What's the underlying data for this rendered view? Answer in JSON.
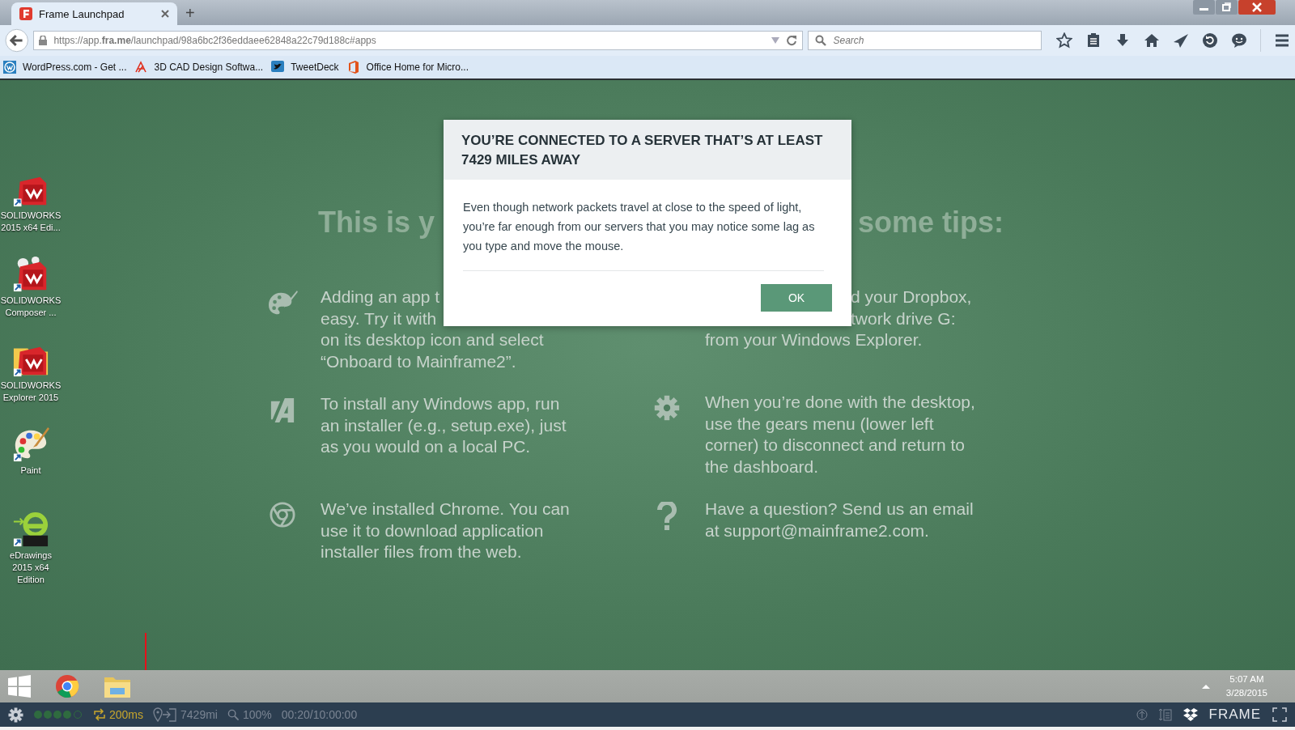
{
  "browser": {
    "tab": {
      "title": "Frame Launchpad",
      "selected": true
    },
    "new_tab": "+",
    "url": "https://app.**fra.me**/launchpad/98a6bc2f36eddaee62848a22c79d188c#apps",
    "search": {
      "placeholder": "Search"
    },
    "bookmarks": [
      {
        "label": "WordPress.com - Get ...",
        "kind": "wordpress"
      },
      {
        "label": "3D CAD Design Softwa...",
        "kind": "cad"
      },
      {
        "label": "TweetDeck",
        "kind": "tweetdeck"
      },
      {
        "label": "Office Home for Micro...",
        "kind": "office"
      }
    ]
  },
  "desktop": {
    "icons": [
      {
        "label": "SOLIDWORKS 2015 x64 Edi...",
        "kind": "solidworks"
      },
      {
        "label": "SOLIDWORKS Composer ...",
        "kind": "composer"
      },
      {
        "label": "SOLIDWORKS Explorer 2015",
        "kind": "explorer"
      },
      {
        "label": "Paint",
        "kind": "paint"
      },
      {
        "label": "eDrawings 2015 x64 Edition",
        "kind": "edrawings"
      }
    ],
    "heading_fragments": [
      "This is y",
      "some tips:"
    ],
    "tips_left": [
      {
        "kind": "palette",
        "lines": [
          "Adding an app t",
          "easy.  Try it with",
          "on its desktop icon and select",
          "“Onboard to Mainframe2”."
        ]
      },
      {
        "kind": "appstore",
        "lines": [
          "To install any Windows app, run",
          "an installer (e.g., setup.exe), just",
          "as you would on a local PC."
        ]
      },
      {
        "kind": "chrome",
        "lines": [
          "We’ve installed Chrome. You can",
          "use it to download application",
          "installer files from the web."
        ]
      }
    ],
    "tips_right": [
      {
        "kind": "covered",
        "lines": [
          "d your Dropbox,",
          "twork drive G:",
          "from your Windows Explorer."
        ]
      },
      {
        "kind": "gear",
        "lines": [
          "When you’re done with the desktop,",
          "use the gears menu (lower left",
          "corner) to disconnect and return to",
          "the dashboard."
        ]
      },
      {
        "kind": "question",
        "lines": [
          "Have a question? Send us an email",
          "at support@mainframe2.com."
        ]
      }
    ]
  },
  "dialog": {
    "title": "YOU’RE CONNECTED TO A SERVER THAT’S AT LEAST 7429 MILES AWAY",
    "body": "Even though network packets travel at close to the speed of light, you’re far enough from our servers that you may notice some lag as you type and move the mouse.",
    "button": "OK"
  },
  "taskbar": {
    "time": "5:07 AM",
    "date": "3/28/2015"
  },
  "status_bar": {
    "latency": "200ms",
    "distance": "7429mi",
    "zoom": "100%",
    "session_time": "00:20/10:00:00",
    "brand": "FRAME"
  }
}
